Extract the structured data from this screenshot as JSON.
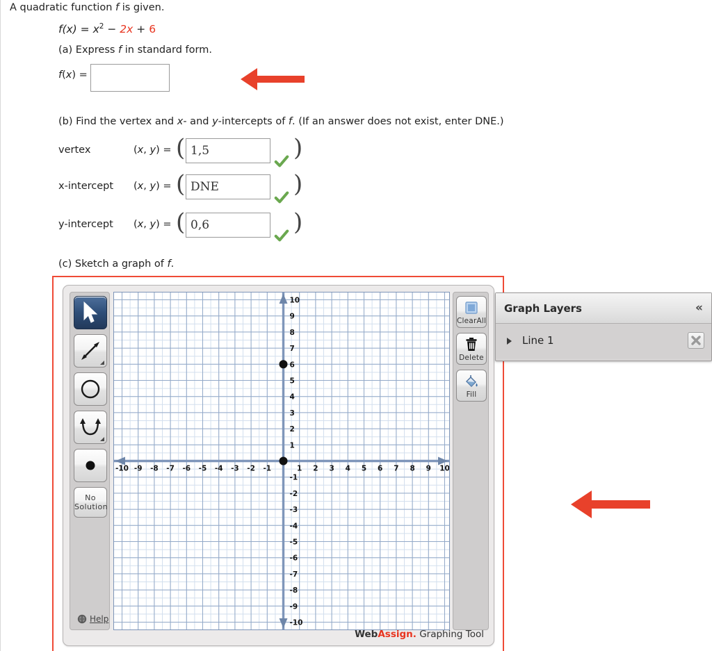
{
  "question": {
    "intro": "A quadratic function f is given.",
    "formula": {
      "lhs": "f(x) = ",
      "term1": "x",
      "exp": "2",
      "op1": " − ",
      "term2": "2x",
      "op2": " + ",
      "term3": "6"
    },
    "part_a": "(a) Express f in standard form.",
    "fx_label": "f(x) = ",
    "fx_value": "",
    "fx_placeholder": "",
    "part_b": "(b) Find the vertex and x- and y-intercepts of f. (If an answer does not exist, enter DNE.)",
    "part_c": "(c) Sketch a graph of f.",
    "rows": [
      {
        "label": "vertex",
        "coord": "(x, y) = ",
        "value": "1,5",
        "paren_l": "(",
        "paren_r": ")",
        "status": "correct"
      },
      {
        "label": "x-intercept",
        "coord": "(x, y) = ",
        "value": "DNE",
        "paren_l": "(",
        "paren_r": ")",
        "status": "correct"
      },
      {
        "label": "y-intercept",
        "coord": "(x, y) = ",
        "value": "0,6",
        "paren_l": "(",
        "paren_r": ")",
        "status": "correct"
      }
    ]
  },
  "graphing_tool": {
    "brand_web": "Web",
    "brand_assign": "Assign.",
    "brand_rest": " Graphing Tool",
    "help_label": "Help",
    "tools": [
      {
        "name": "select-tool",
        "icon": "arrow-cursor-icon",
        "selected": true,
        "has_corner": false
      },
      {
        "name": "line-tool",
        "icon": "double-arrow-line-icon",
        "selected": false,
        "has_corner": true
      },
      {
        "name": "circle-tool",
        "icon": "circle-icon",
        "selected": false,
        "has_corner": false
      },
      {
        "name": "parabola-tool",
        "icon": "parabola-icon",
        "selected": false,
        "has_corner": true
      },
      {
        "name": "point-tool",
        "icon": "filled-dot-icon",
        "selected": false,
        "has_corner": false
      },
      {
        "name": "no-solution-tool",
        "icon": "text-icon",
        "selected": false,
        "has_corner": false,
        "label_line1": "No",
        "label_line2": "Solution"
      }
    ],
    "actions": [
      {
        "name": "clear-all-button",
        "label": "ClearAll",
        "icon": "square-icon"
      },
      {
        "name": "delete-button",
        "label": "Delete",
        "icon": "trash-icon"
      },
      {
        "name": "fill-button",
        "label": "Fill",
        "icon": "paint-bucket-icon"
      }
    ]
  },
  "layers_panel": {
    "title": "Graph Layers",
    "collapse_glyph": "«",
    "items": [
      {
        "name": "Line 1",
        "expand_glyph": "▸",
        "close_glyph": "✕"
      }
    ]
  },
  "chart_data": {
    "type": "scatter",
    "title": "",
    "xlabel": "",
    "ylabel": "",
    "xlim": [
      -10.5,
      10.5
    ],
    "ylim": [
      -10.5,
      10.5
    ],
    "x_ticks": [
      -10,
      -9,
      -8,
      -7,
      -6,
      -5,
      -4,
      -3,
      -2,
      -1,
      1,
      2,
      3,
      4,
      5,
      6,
      7,
      8,
      9,
      10
    ],
    "y_ticks": [
      10,
      9,
      8,
      7,
      6,
      5,
      4,
      3,
      2,
      1,
      -1,
      -2,
      -3,
      -4,
      -5,
      -6,
      -7,
      -8,
      -9,
      -10
    ],
    "grid": true,
    "grid_major_color": "#93a9c8",
    "grid_minor_color": "#d3dfee",
    "axis_color": "#7f96ba",
    "points": [
      {
        "x": 0,
        "y": 6,
        "color": "#111111"
      },
      {
        "x": 0,
        "y": 0,
        "color": "#111111"
      }
    ],
    "legend": "none"
  },
  "annotations": {
    "arrows": [
      {
        "name": "red-arrow-top",
        "direction": "left",
        "color": "#e8412b"
      },
      {
        "name": "red-arrow-bottom",
        "direction": "left",
        "color": "#e8412b"
      }
    ]
  },
  "colors": {
    "accent_red": "#e8341f",
    "arrow_red": "#e8412b",
    "check_green": "#6aa84f",
    "frame_red": "#ef4a36"
  }
}
